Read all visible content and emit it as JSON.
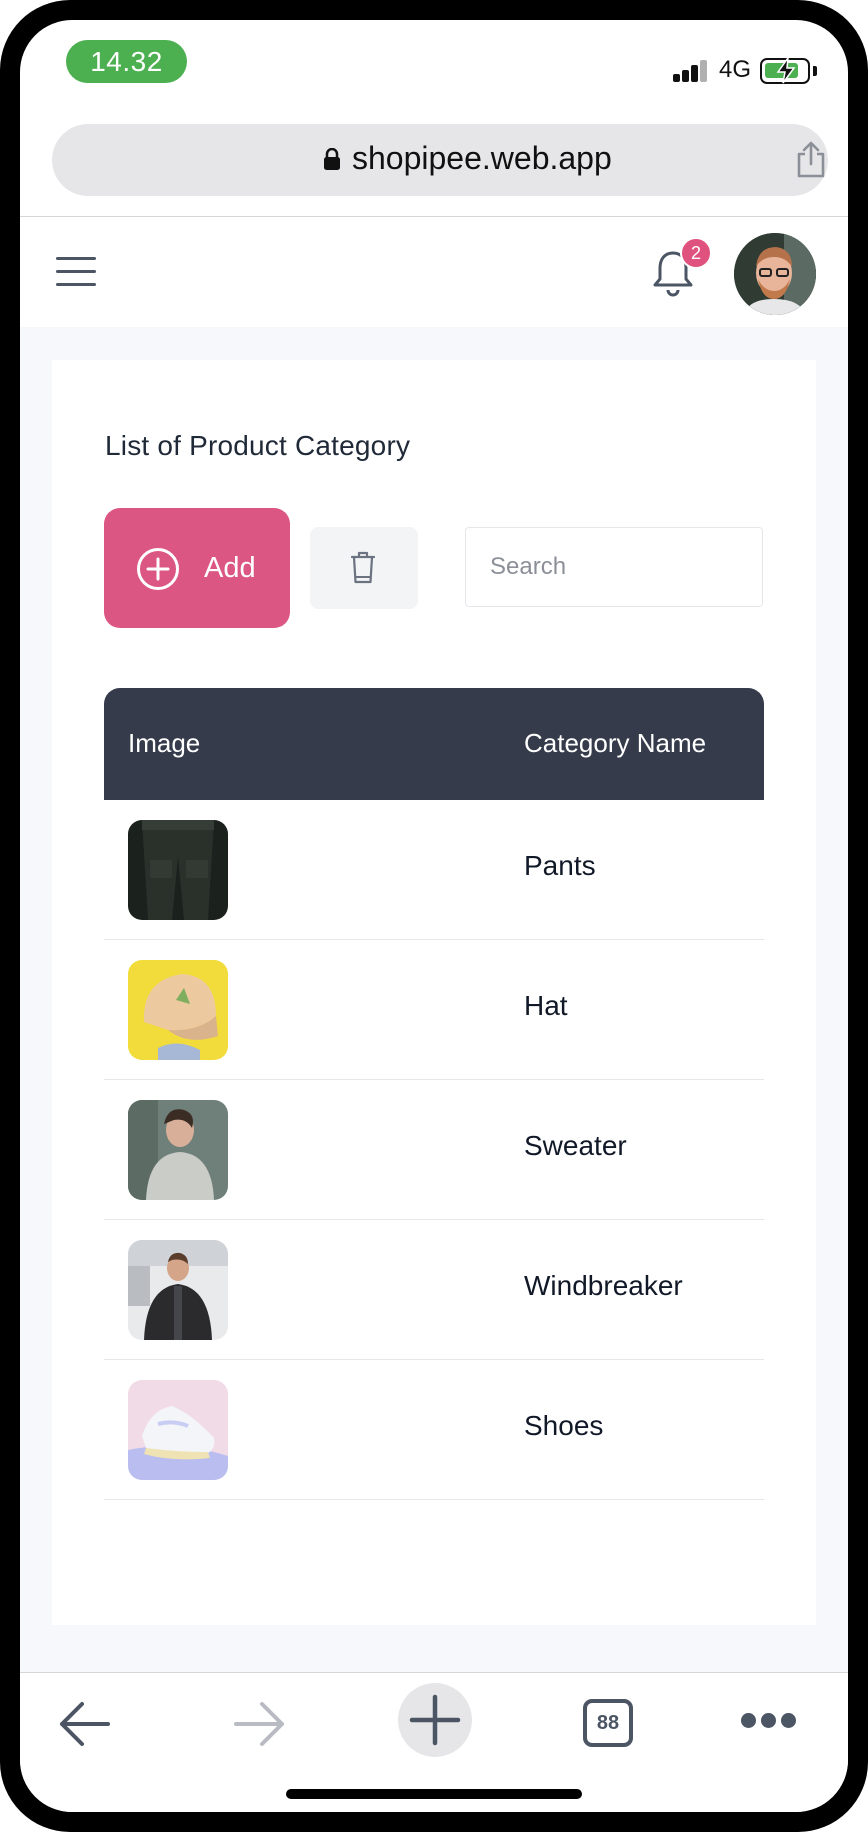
{
  "status_bar": {
    "time": "14.32",
    "network": "4G"
  },
  "browser": {
    "url": "shopipee.web.app"
  },
  "header": {
    "notification_count": "2"
  },
  "page": {
    "title": "List of Product Category",
    "add_label": "Add",
    "search_placeholder": "Search"
  },
  "table": {
    "columns": [
      "Image",
      "Category Name"
    ],
    "rows": [
      {
        "name": "Pants",
        "thumb": "pants-photo"
      },
      {
        "name": "Hat",
        "thumb": "hat-photo"
      },
      {
        "name": "Sweater",
        "thumb": "sweater-photo"
      },
      {
        "name": "Windbreaker",
        "thumb": "windbreaker-photo"
      },
      {
        "name": "Shoes",
        "thumb": "shoes-photo"
      }
    ]
  },
  "toolbar": {
    "tab_count": "88"
  },
  "colors": {
    "accent": "#dc5683",
    "table_header": "#353b4a",
    "time_pill": "#4caf50"
  }
}
